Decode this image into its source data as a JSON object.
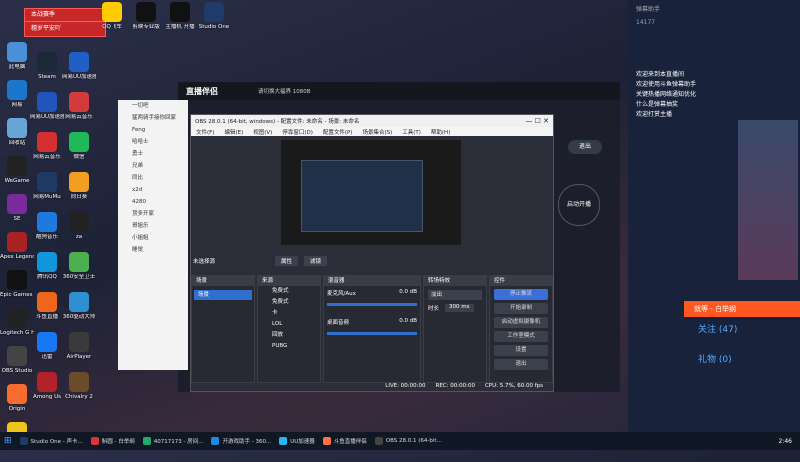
{
  "overlay": {
    "line1": "本战赛季",
    "line2": "穗岁平安吖"
  },
  "desktop_icons": [
    {
      "label": "此电脑",
      "color": "#4a90d9"
    },
    {
      "label": "网易",
      "color": "#1a77c9"
    },
    {
      "label": "回收站",
      "color": "#6aa5d8"
    },
    {
      "label": "WeGame",
      "color": "#222"
    },
    {
      "label": "SE",
      "color": "#7a2b9a"
    },
    {
      "label": "Apex Legends",
      "color": "#aa2222"
    },
    {
      "label": "Epic Games Launcher",
      "color": "#111"
    },
    {
      "label": "Logitech G HUB",
      "color": "#222"
    },
    {
      "label": "OBS Studio",
      "color": "#444"
    },
    {
      "label": "Origin",
      "color": "#f56c2d"
    },
    {
      "label": "PotPlayer 64 bit",
      "color": "#f0c419"
    }
  ],
  "desktop_icons2": [
    {
      "label": "Steam",
      "color": "#1b2838"
    },
    {
      "label": "网易UU加速器",
      "color": "#2255bb"
    },
    {
      "label": "网易云音乐",
      "color": "#d53030"
    },
    {
      "label": "网易MuMu",
      "color": "#1e3b66"
    },
    {
      "label": "酷狗音乐",
      "color": "#1f7ae0"
    },
    {
      "label": "腾讯QQ",
      "color": "#1296db"
    },
    {
      "label": "斗鱼直播",
      "color": "#f0651c"
    },
    {
      "label": "迅雷",
      "color": "#1877f2"
    },
    {
      "label": "Among Us",
      "color": "#b3212b"
    }
  ],
  "desktop_icons3": [
    {
      "label": "网易UU加速器",
      "color": "#1f5fc7"
    },
    {
      "label": "网易云音乐",
      "color": "#d33b3b"
    },
    {
      "label": "微信",
      "color": "#21b85a"
    },
    {
      "label": "向日葵",
      "color": "#f29e22"
    },
    {
      "label": "za",
      "color": "#222"
    },
    {
      "label": "360安全卫士",
      "color": "#4caf50"
    },
    {
      "label": "360驱动大师",
      "color": "#2e90d1"
    },
    {
      "label": "AirPlayer",
      "color": "#3a3a3a"
    },
    {
      "label": "Chivalry 2",
      "color": "#6b4c2a"
    }
  ],
  "top_icons": [
    {
      "label": "QQ飞车",
      "color": "#ffcc00"
    },
    {
      "label": "剪映专业版",
      "color": "#111"
    },
    {
      "label": "主播机 开播",
      "color": "#111"
    },
    {
      "label": "Studio One",
      "color": "#1f3b6a"
    }
  ],
  "zbbl": {
    "title": "直播伴侣",
    "subtitle": "请切换大福界 1080B",
    "side_items": [
      "一切吧",
      "猛两骑手接你回家",
      "Feng",
      "哈哈士",
      "勇士",
      "兄弟",
      "同比",
      "x2d",
      "4280",
      "顶多开家",
      "哥姐乐",
      "小姐姐",
      "睡觉"
    ],
    "start_label": "启动开播",
    "right_btn": "退出",
    "follow": "开播直播点击"
  },
  "obs": {
    "title": "OBS 28.0.1 (64-bit, windows) - 配置文件: 未命名 - 场景: 未命名",
    "menu": [
      "文件(F)",
      "编辑(E)",
      "视图(V)",
      "停靠窗口(D)",
      "配置文件(P)",
      "场景集合(S)",
      "工具(T)",
      "帮助(H)"
    ],
    "no_source": "未选择源",
    "props": "属性",
    "filters": "滤镜",
    "docks": {
      "scenes": "场景",
      "sources": "来源",
      "mixer": "混音器",
      "transitions": "转场特效",
      "controls": "控件"
    },
    "scene_item": "场景",
    "sources": [
      "免费式",
      "免费式",
      "卡",
      "LOL",
      "回放",
      "PUBG"
    ],
    "mixer": [
      {
        "name": "麦克风/Aux",
        "db": "0.0 dB"
      },
      {
        "name": "桌面音频",
        "db": "0.0 dB"
      }
    ],
    "transition": "淡出",
    "duration_label": "时长",
    "duration": "300 ms",
    "controls": [
      "停止推流",
      "开始录制",
      "启动虚拟摄像机",
      "工作室模式",
      "设置",
      "退出"
    ],
    "status": {
      "live": "LIVE: 00:00:00",
      "rec": "REC: 00:00:00",
      "cpu": "CPU: 5.7%, 60.00 fps"
    }
  },
  "right": {
    "title": "弹幕助手",
    "count": "14177",
    "msgs": [
      "欢迎来到本直播间",
      "欢迎使用斗鱼弹幕助手",
      "关键热播网络通知优化",
      "什么是弹幕抽奖",
      "欢迎打赏主播"
    ],
    "name": "就等 - 白举纲",
    "stat1": "关注 (47)",
    "stat2": "礼物 (0)"
  },
  "taskbar": [
    {
      "label": "Studio One - 声卡..."
    },
    {
      "label": "斛圆 - 白举纲"
    },
    {
      "label": "40717173 - 房间..."
    },
    {
      "label": "开游戏助手 - 360..."
    },
    {
      "label": "UU加速器"
    },
    {
      "label": "斗鱼直播伴侣"
    },
    {
      "label": "OBS 28.0.1 (64-bit..."
    }
  ],
  "clock": "2:46"
}
